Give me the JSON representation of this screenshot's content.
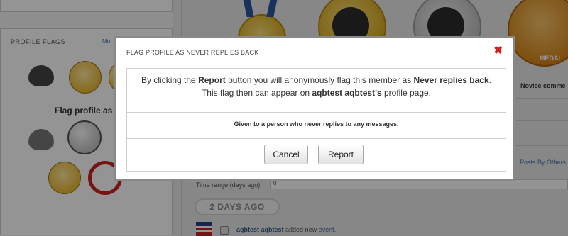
{
  "background": {
    "profile_flags_title": "PROFILE FLAGS",
    "more_link": "Mo",
    "flag_profile_as": "Flag profile as",
    "medal_label": "MEDAL",
    "novice_text": "Novice comme",
    "posts_by_others": "Posts By Others",
    "time_range_label": "Time range (days ago):",
    "time_range_value": "0",
    "days_ago_pill": "2 DAYS AGO",
    "activity": {
      "user": "aqbtest aqbtest",
      "action": "added new",
      "object": "event."
    },
    "icons": [
      "muscle-icon",
      "neutral-face-icon",
      "soccer-ball-icon",
      "smiley-icon",
      "spam-icon",
      "medal-icon",
      "trophy-icon"
    ]
  },
  "modal": {
    "title": "FLAG PROFILE AS NEVER REPLIES BACK",
    "close_symbol": "✖",
    "message": {
      "part1": "By clicking the ",
      "report_word": "Report",
      "part2": " button you will anonymously flag this member as ",
      "flag_name": "Never replies back",
      "part3": ".",
      "part4": "This flag then can appear on ",
      "member_name": "aqbtest aqbtest's",
      "part5": " profile page."
    },
    "description": "Given to a person who never replies to any messages.",
    "cancel_label": "Cancel",
    "report_label": "Report"
  },
  "colors": {
    "close_red": "#d61d1d",
    "overlay": "rgba(0,0,0,0.42)"
  }
}
